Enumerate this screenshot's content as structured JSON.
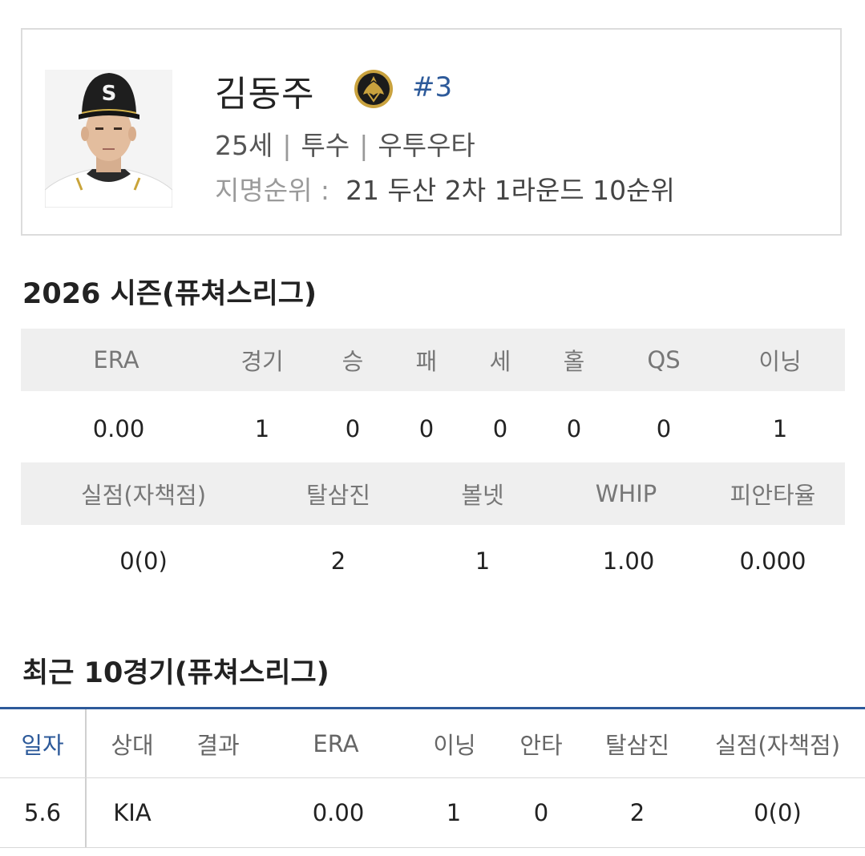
{
  "profile": {
    "name": "김동주",
    "number": "#3",
    "age": "25세",
    "position": "투수",
    "hand": "우투우타",
    "draft_label": "지명순위 :",
    "draft_value": "21 두산 2차 1라운드 10순위",
    "photo_icon": "player-photo",
    "emblem_icon": "team-emblem-icon",
    "cap_letter": "S"
  },
  "season": {
    "title": "2026 시즌(퓨쳐스리그)",
    "row1_headers": [
      "ERA",
      "경기",
      "승",
      "패",
      "세",
      "홀",
      "QS",
      "이닝"
    ],
    "row1_values": [
      "0.00",
      "1",
      "0",
      "0",
      "0",
      "0",
      "0",
      "1"
    ],
    "row2_headers": [
      "실점(자책점)",
      "탈삼진",
      "볼넷",
      "WHIP",
      "피안타율"
    ],
    "row2_values": [
      "0(0)",
      "2",
      "1",
      "1.00",
      "0.000"
    ]
  },
  "recent": {
    "title": "최근 10경기(퓨쳐스리그)",
    "headers": [
      "일자",
      "상대",
      "결과",
      "ERA",
      "이닝",
      "안타",
      "탈삼진",
      "실점(자책점)"
    ],
    "rows": [
      [
        "5.6",
        "KIA",
        "",
        "0.00",
        "1",
        "0",
        "2",
        "0(0)"
      ]
    ]
  },
  "colors": {
    "accent": "#2d5a9a",
    "header_bg": "#efefef",
    "border": "#dcdcdc"
  }
}
